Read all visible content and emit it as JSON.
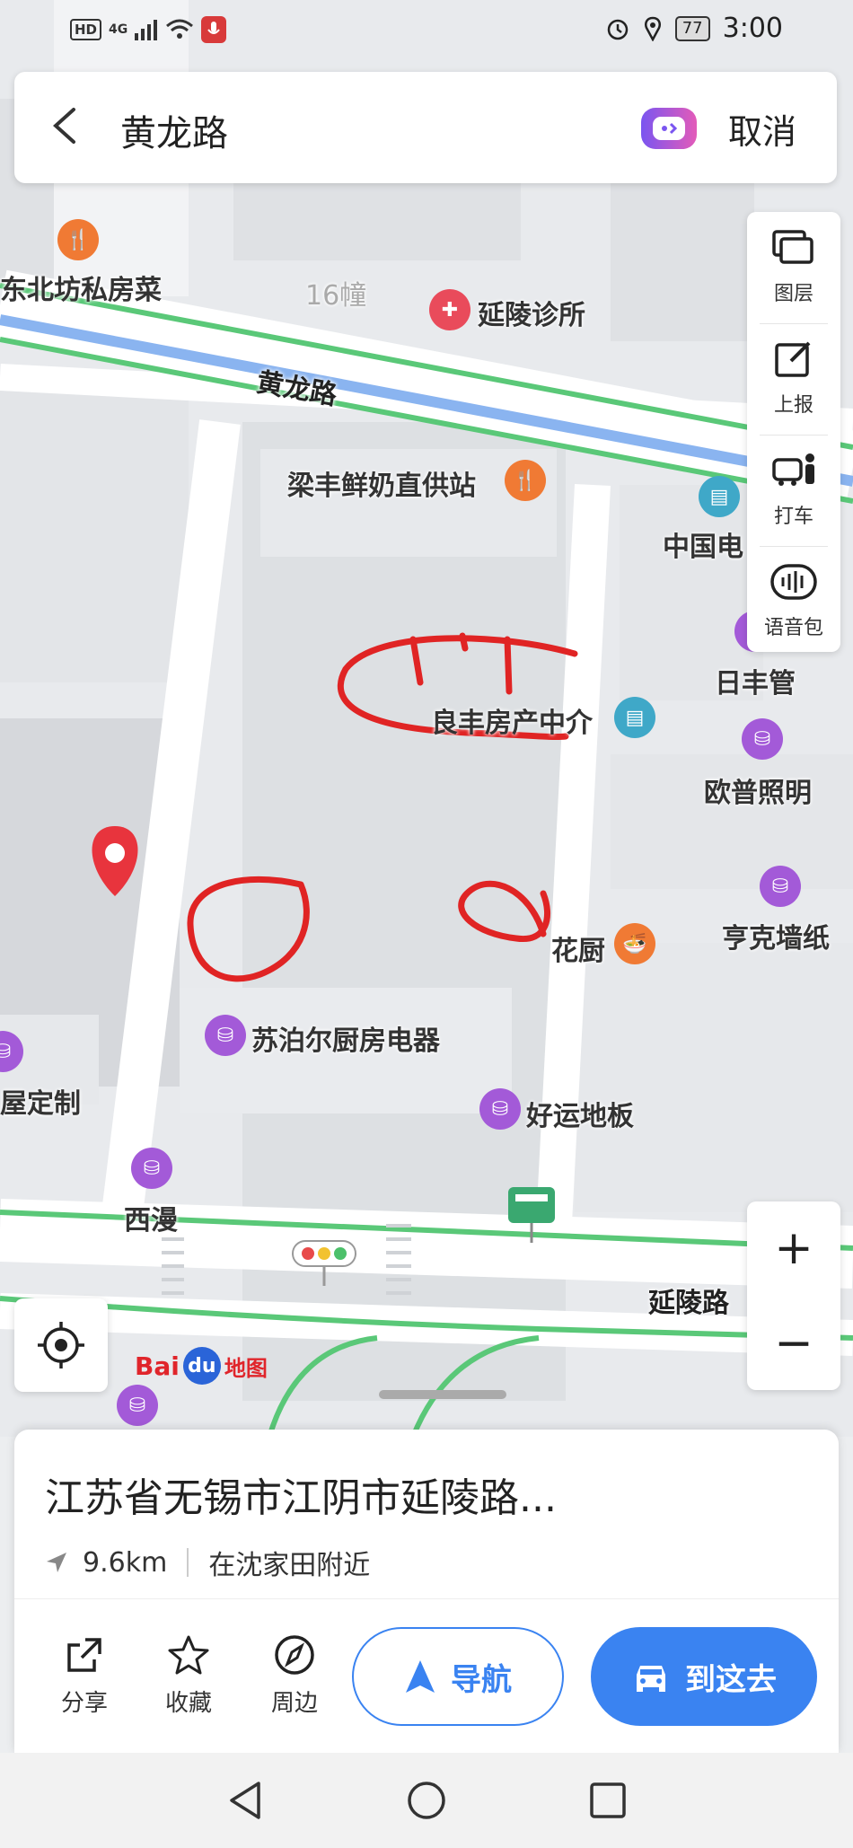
{
  "status_bar": {
    "hd": "HD",
    "network": "4G",
    "battery": "77",
    "time": "3:00",
    "icons": [
      "signal-icon",
      "wifi-icon",
      "mic-icon",
      "alarm-icon",
      "location-icon",
      "battery-icon"
    ]
  },
  "search": {
    "query": "黄龙路",
    "cancel_label": "取消"
  },
  "map": {
    "roads": [
      "黄龙路",
      "延陵路"
    ],
    "pois": [
      {
        "name": "东北坊私房菜",
        "type": "restaurant"
      },
      {
        "name": "16幢",
        "type": "building"
      },
      {
        "name": "延陵诊所",
        "type": "clinic"
      },
      {
        "name": "梁丰鲜奶直供站",
        "type": "restaurant"
      },
      {
        "name": "中国电",
        "type": "shop"
      },
      {
        "name": "日丰管",
        "type": "shop"
      },
      {
        "name": "良丰房产中介",
        "type": "service"
      },
      {
        "name": "欧普照明",
        "type": "shop"
      },
      {
        "name": "亨克墙纸",
        "type": "shop"
      },
      {
        "name": "花厨",
        "type": "restaurant"
      },
      {
        "name": "苏泊尔厨房电器",
        "type": "shop"
      },
      {
        "name": "好运地板",
        "type": "shop"
      },
      {
        "name": "西漫",
        "type": "shop"
      },
      {
        "name": "屋定制",
        "type": "shop"
      }
    ],
    "logo_text": "Bai",
    "logo_du": "du",
    "logo_suffix": "地图"
  },
  "tools": [
    {
      "label": "图层",
      "icon": "layers-icon"
    },
    {
      "label": "上报",
      "icon": "report-icon"
    },
    {
      "label": "打车",
      "icon": "taxi-icon"
    },
    {
      "label": "语音包",
      "icon": "voice-pack-icon"
    }
  ],
  "zoom": {
    "in": "+",
    "out": "−"
  },
  "place": {
    "address": "江苏省无锡市江阴市延陵路...",
    "distance": "9.6km",
    "nearby": "在沈家田附近"
  },
  "actions": {
    "share": "分享",
    "favorite": "收藏",
    "nearby": "周边",
    "navigate": "导航",
    "go_here": "到这去"
  },
  "colors": {
    "accent": "#3a83f1",
    "road_green": "#5ac878",
    "road_blue": "#8ab4f0",
    "annotation_red": "#e02424",
    "poi_purple": "#a35ad8",
    "poi_orange": "#f07a34"
  }
}
